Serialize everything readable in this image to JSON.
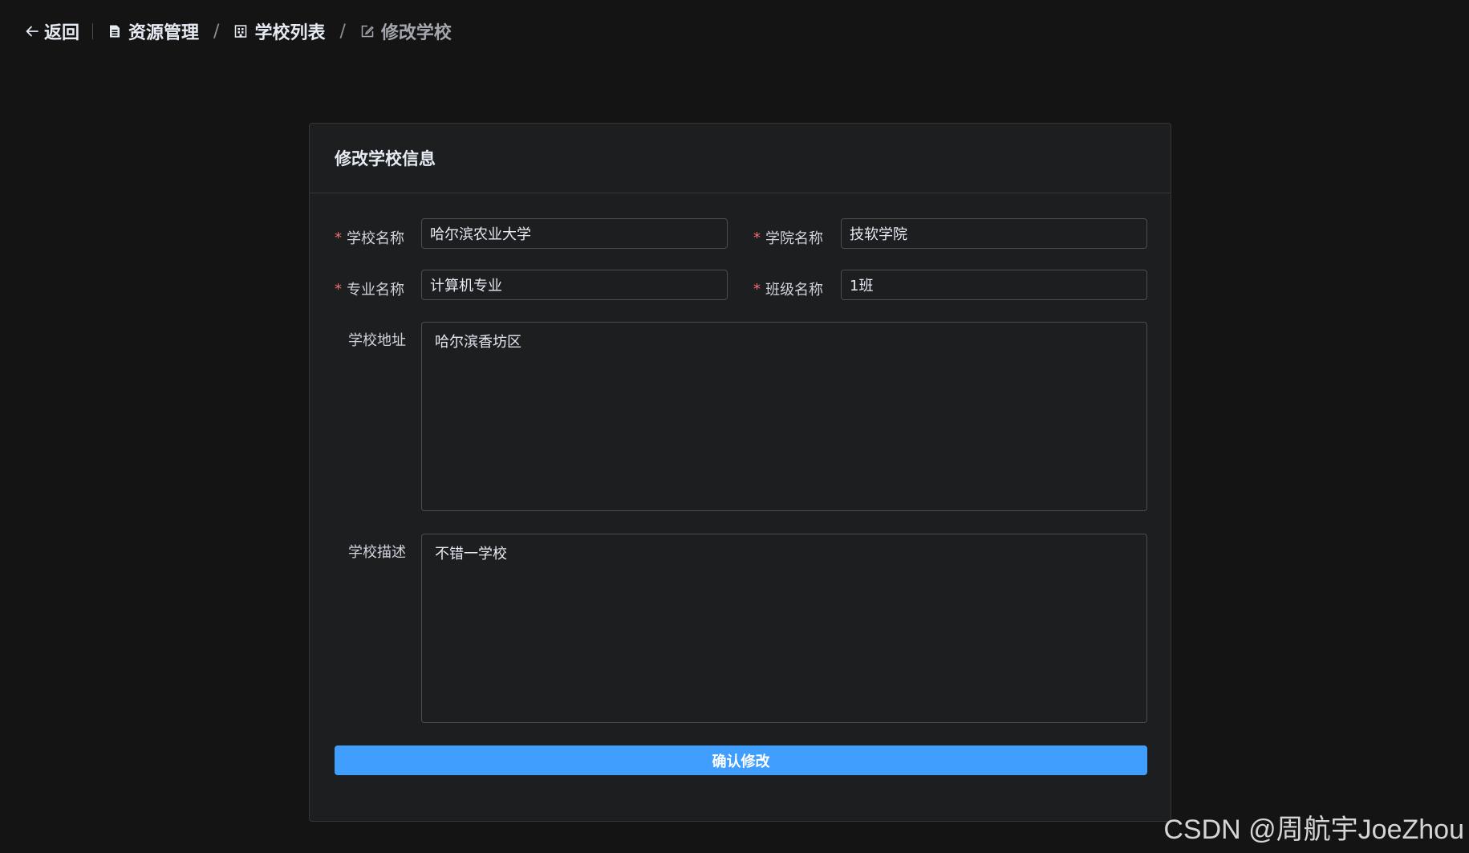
{
  "header": {
    "back_label": "返回",
    "breadcrumbs": [
      {
        "label": "资源管理",
        "icon": "document-icon"
      },
      {
        "label": "学校列表",
        "icon": "building-icon"
      },
      {
        "label": "修改学校",
        "icon": "edit-icon"
      }
    ],
    "separator": "/"
  },
  "form": {
    "title": "修改学校信息",
    "fields": {
      "school_name": {
        "label": "学校名称",
        "value": "哈尔滨农业大学",
        "required": true
      },
      "college_name": {
        "label": "学院名称",
        "value": "技软学院",
        "required": true
      },
      "major_name": {
        "label": "专业名称",
        "value": "计算机专业",
        "required": true
      },
      "class_name": {
        "label": "班级名称",
        "value": "1班",
        "required": true
      },
      "address": {
        "label": "学校地址",
        "value": "哈尔滨香坊区",
        "required": false
      },
      "description": {
        "label": "学校描述",
        "value": "不错一学校",
        "required": false
      }
    },
    "required_mark": "*",
    "submit_label": "确认修改"
  },
  "watermark": "CSDN @周航宇JoeZhou",
  "colors": {
    "background": "#141414",
    "card": "#1d1e1f",
    "primary": "#409eff",
    "required": "#f56c6c"
  }
}
